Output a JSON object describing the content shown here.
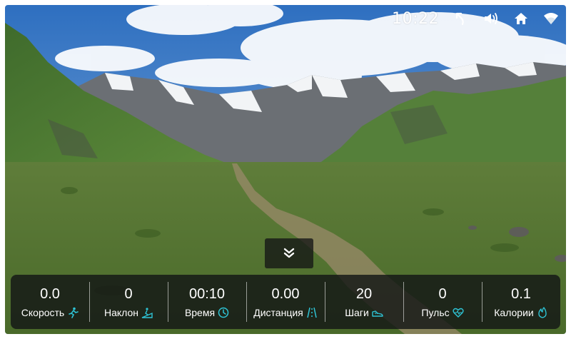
{
  "status_bar": {
    "time": "10:22",
    "icons": [
      "back-icon",
      "volume-icon",
      "home-icon",
      "wifi-icon"
    ]
  },
  "collapse_button": {
    "icon": "double-chevron-down-icon"
  },
  "stats": [
    {
      "value": "0.0",
      "label": "Скорость",
      "icon": "running-icon"
    },
    {
      "value": "0",
      "label": "Наклон",
      "icon": "incline-icon"
    },
    {
      "value": "00:10",
      "label": "Время",
      "icon": "clock-icon"
    },
    {
      "value": "0.00",
      "label": "Дистанция",
      "icon": "road-icon"
    },
    {
      "value": "20",
      "label": "Шаги",
      "icon": "shoe-icon"
    },
    {
      "value": "0",
      "label": "Пульс",
      "icon": "heart-pulse-icon"
    },
    {
      "value": "0.1",
      "label": "Калории",
      "icon": "flame-icon"
    }
  ],
  "colors": {
    "accent": "#2ec4d6",
    "bar_bg": "#141616"
  }
}
